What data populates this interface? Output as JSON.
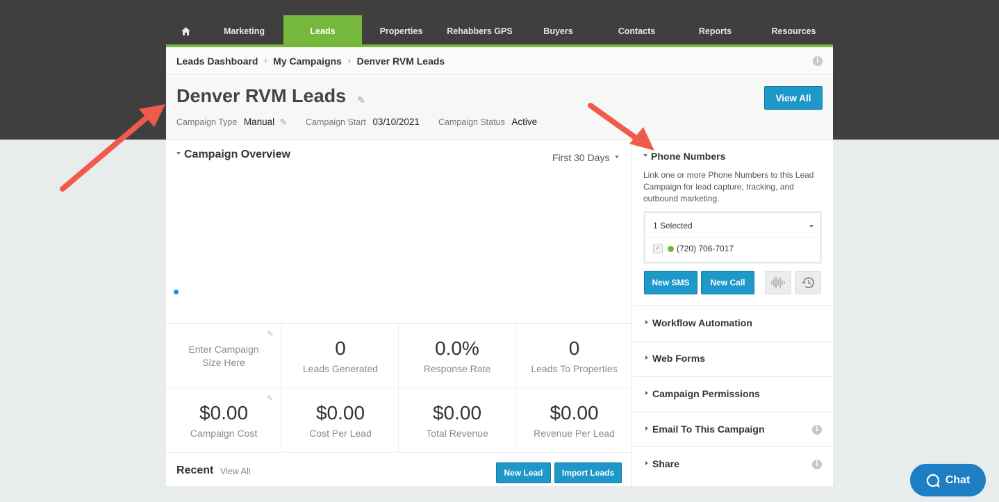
{
  "nav": {
    "items": [
      {
        "label": "Marketing"
      },
      {
        "label": "Leads"
      },
      {
        "label": "Properties"
      },
      {
        "label": "Rehabbers GPS"
      },
      {
        "label": "Buyers"
      },
      {
        "label": "Contacts"
      },
      {
        "label": "Reports"
      },
      {
        "label": "Resources"
      }
    ],
    "active": "Leads",
    "home_icon": "home-icon"
  },
  "breadcrumb": [
    "Leads Dashboard",
    "My Campaigns",
    "Denver RVM Leads"
  ],
  "header": {
    "title": "Denver RVM Leads",
    "campaign_type_label": "Campaign Type",
    "campaign_type_value": "Manual",
    "campaign_start_label": "Campaign Start",
    "campaign_start_value": "03/10/2021",
    "campaign_status_label": "Campaign Status",
    "campaign_status_value": "Active",
    "view_all_label": "View All"
  },
  "overview": {
    "title": "Campaign Overview",
    "range": "First 30 Days"
  },
  "stats": {
    "size_placeholder": "Enter Campaign Size Here",
    "leads_generated": {
      "value": "0",
      "label": "Leads Generated"
    },
    "response_rate": {
      "value": "0.0%",
      "label": "Response Rate"
    },
    "leads_to_properties": {
      "value": "0",
      "label": "Leads To Properties"
    },
    "campaign_cost": {
      "value": "$0.00",
      "label": "Campaign Cost"
    },
    "cost_per_lead": {
      "value": "$0.00",
      "label": "Cost Per Lead"
    },
    "total_revenue": {
      "value": "$0.00",
      "label": "Total Revenue"
    },
    "revenue_per_lead": {
      "value": "$0.00",
      "label": "Revenue Per Lead"
    }
  },
  "recent": {
    "title": "Recent",
    "view_all": "View All",
    "new_lead": "New Lead",
    "import_leads": "Import Leads"
  },
  "phone_numbers": {
    "title": "Phone Numbers",
    "description": "Link one or more Phone Numbers to this Lead Campaign for lead capture, tracking, and outbound marketing.",
    "selected": "1 Selected",
    "number": "(720) 706-7017",
    "new_sms": "New SMS",
    "new_call": "New Call"
  },
  "accordion": {
    "workflow": "Workflow Automation",
    "web_forms": "Web Forms",
    "permissions": "Campaign Permissions",
    "email": "Email To This Campaign",
    "share": "Share"
  },
  "chat": {
    "label": "Chat"
  },
  "colors": {
    "nav_bg": "#3f3f3f",
    "accent_green": "#75b83b",
    "button_blue": "#1e97c9",
    "chat_blue": "#1e7ec4",
    "annotation_arrow": "#f05a4b"
  }
}
